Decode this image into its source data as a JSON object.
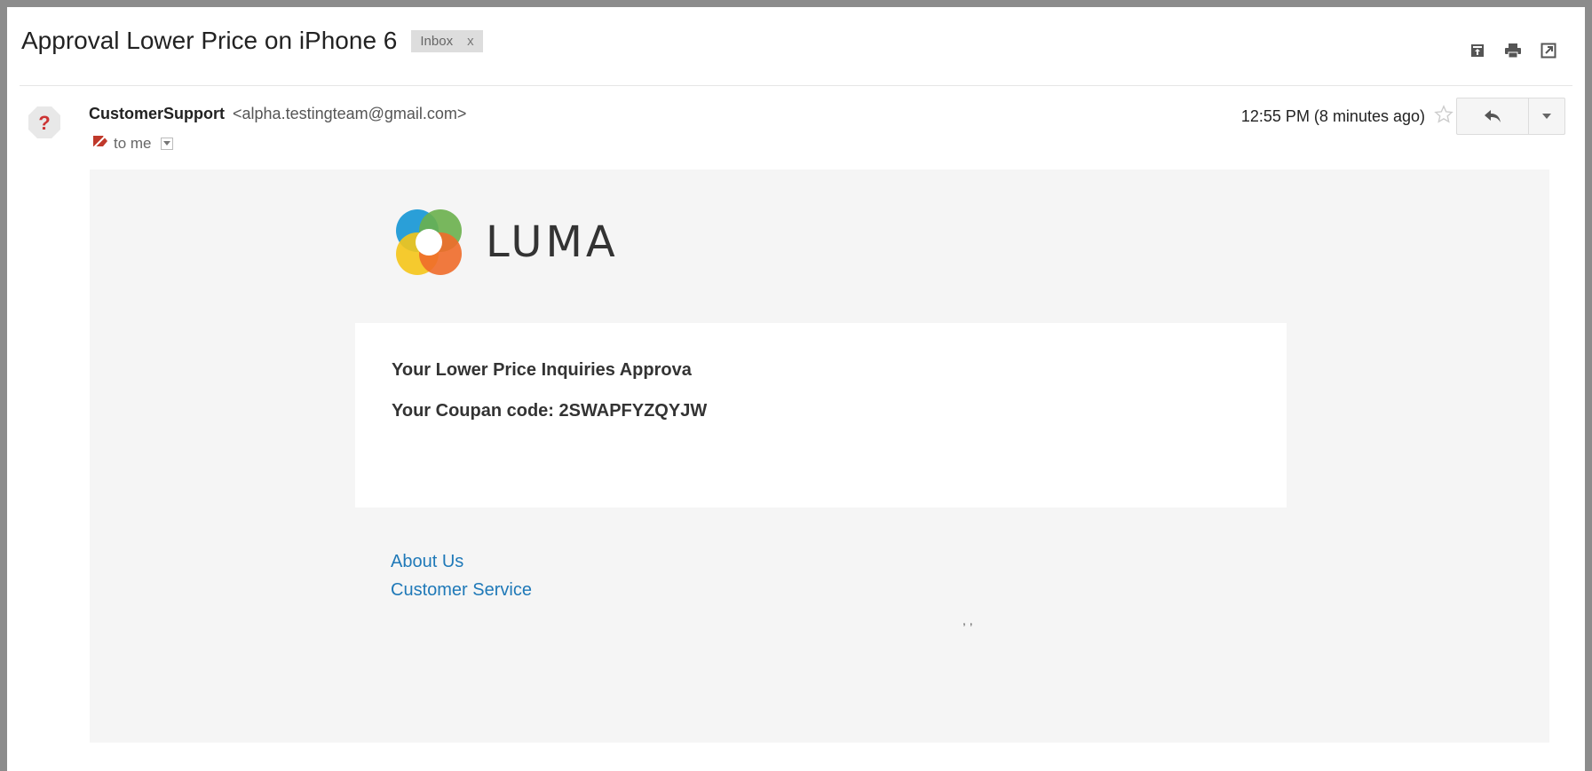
{
  "email": {
    "subject": "Approval Lower Price on iPhone 6",
    "label": "Inbox",
    "label_remove": "x"
  },
  "header": {
    "icons": [
      "archive-icon",
      "print-icon",
      "new-window-icon"
    ]
  },
  "sender": {
    "avatar_glyph": "?",
    "name": "CustomerSupport",
    "email": "<alpha.testingteam@gmail.com>",
    "recipient": "to me",
    "time": "12:55 PM (8 minutes ago)"
  },
  "body": {
    "brand": "LUMA",
    "lines": [
      "Your Lower Price Inquiries Approva",
      "Your Coupan code: 2SWAPFYZQYJW"
    ],
    "footer_links": [
      "About Us",
      "Customer Service"
    ],
    "address": ", ,"
  },
  "colors": {
    "accent_link": "#1f79b8",
    "body_bg": "#f5f5f5",
    "frame": "#8c8c8c"
  }
}
